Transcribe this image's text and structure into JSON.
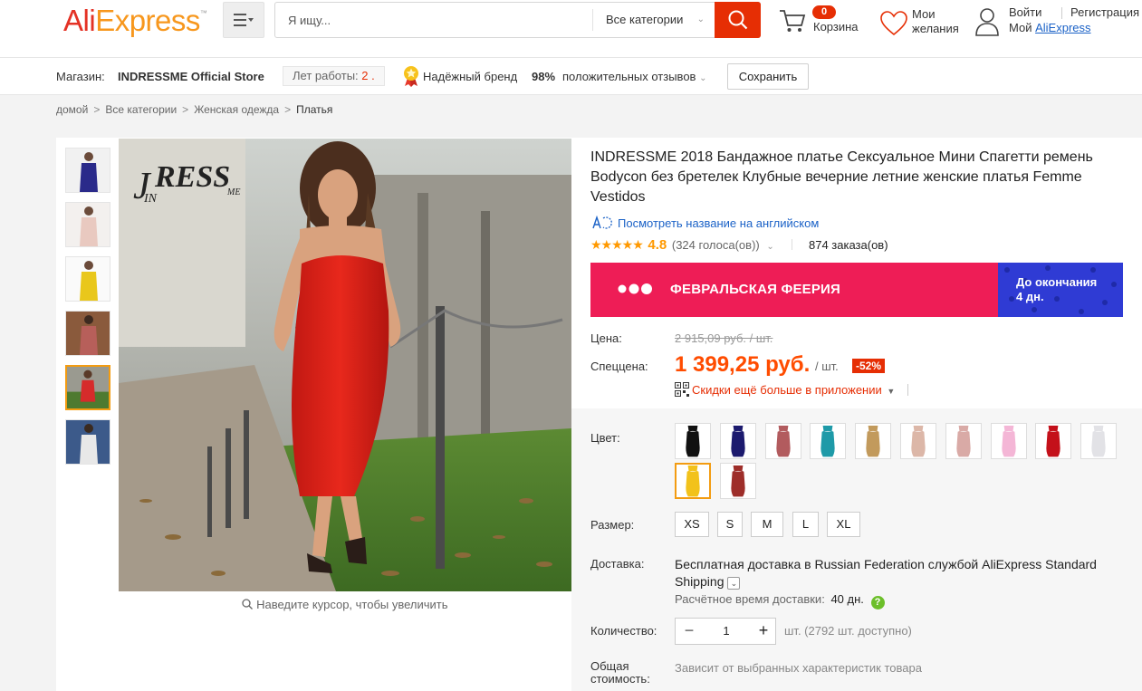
{
  "header": {
    "logo": {
      "part1": "Ali",
      "part2": "Express",
      "tm": "™"
    },
    "search": {
      "placeholder": "Я ищу...",
      "category": "Все категории"
    },
    "cart": {
      "count": "0",
      "label": "Корзина"
    },
    "wishlist": {
      "line1": "Мои",
      "line2": "желания"
    },
    "account": {
      "login": "Войти",
      "register": "Регистрация",
      "my_prefix": "Мой",
      "my_link": "AliExpress"
    }
  },
  "store": {
    "label": "Магазин:",
    "name": "INDRESSME Official Store",
    "years_label": "Лет работы:",
    "years_value": "2 .",
    "brand": "Надёжный бренд",
    "positive_pct": "98%",
    "positive_label": "положительных отзывов",
    "save": "Сохранить"
  },
  "breadcrumb": [
    "домой",
    "Все категории",
    "Женская одежда",
    "Платья"
  ],
  "breadcrumb_sep": ">",
  "gallery": {
    "zoom_hint": "Наведите курсор, чтобы увеличить",
    "logo_text": "RESS",
    "logo_suffix": "ME",
    "thumb_colors": [
      "#2a2a8a",
      "#e9c9c0",
      "#e9c71b",
      "#b75f5a",
      "#d62b2b",
      "#e8e8e8"
    ]
  },
  "product": {
    "title": "INDRESSME 2018 Бандажное платье Сексуальное Мини Спагетти ремень Bodycon без бретелек Клубные вечерние летние женские платья Femme Vestidos",
    "translate": "Посмотреть название на английском",
    "stars": "★★★★★",
    "rating": "4.8",
    "votes": "(324 голоса(ов))",
    "orders": "874 заказа(ов)"
  },
  "banner": {
    "title": "ФЕВРАЛЬСКАЯ ФЕЕРИЯ",
    "countdown_line1": "До окончания",
    "countdown_line2": "4 дн."
  },
  "price": {
    "label": "Цена:",
    "old": "2 915,09 руб. / шт.",
    "sale_label": "Спеццена:",
    "sale": "1 399,25 руб.",
    "per": "/ шт.",
    "discount": "-52%",
    "app_discount": "Скидки ещё больше в приложении"
  },
  "options": {
    "color_label": "Цвет:",
    "colors": [
      "#111111",
      "#1c1a6e",
      "#b25b5e",
      "#1e9aa8",
      "#c29a5c",
      "#dcb7a8",
      "#d9aaa6",
      "#f4b6d6",
      "#c4101a",
      "#e2e2e6",
      "#f2c21b",
      "#9e2e2a"
    ],
    "size_label": "Размер:",
    "sizes": [
      "XS",
      "S",
      "M",
      "L",
      "XL"
    ],
    "shipping_label": "Доставка:",
    "shipping_text": "Бесплатная доставка в Russian Federation службой AliExpress Standard Shipping",
    "eta_label": "Расчётное время доставки:",
    "eta_value": "40 дн.",
    "qty_label": "Количество:",
    "qty_value": "1",
    "qty_avail": "шт. (2792 шт. доступно)",
    "total_label_1": "Общая",
    "total_label_2": "стоимость:",
    "total_note": "Зависит от выбранных характеристик товара"
  }
}
